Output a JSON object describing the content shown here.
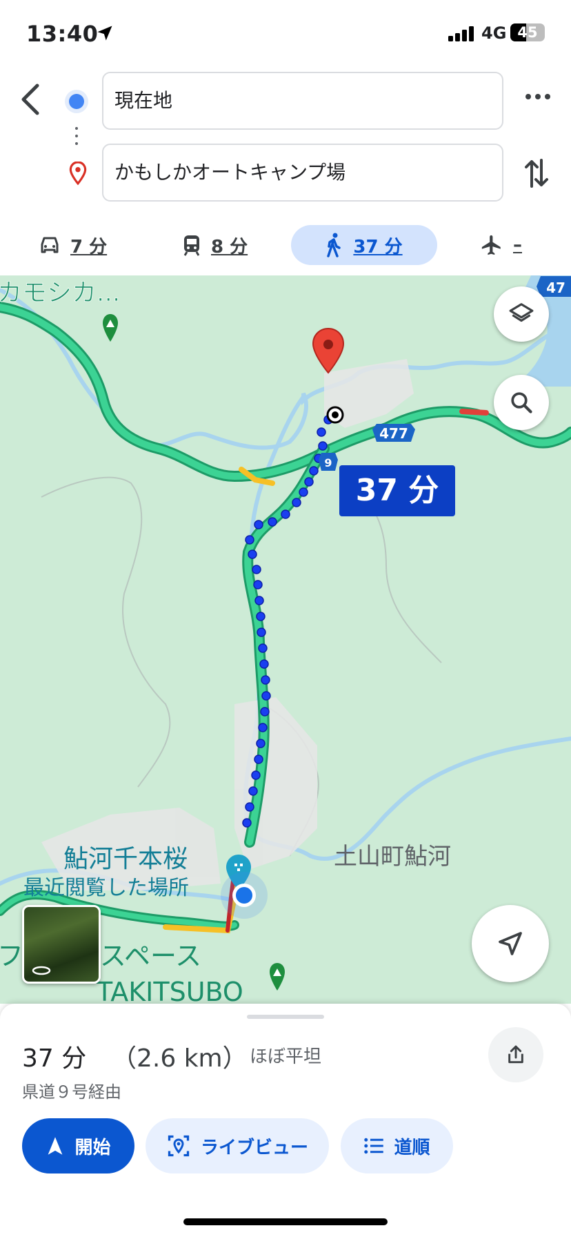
{
  "status_bar": {
    "time": "13:40",
    "network": "4G",
    "battery": "45",
    "battery_level": 0.45
  },
  "directions": {
    "origin": "現在地",
    "destination": "かもしかオートキャンプ場"
  },
  "modes": [
    {
      "icon": "car-icon",
      "time": "7 分"
    },
    {
      "icon": "train-icon",
      "time": "8 分"
    },
    {
      "icon": "walk-icon",
      "time": "37 分",
      "selected": true
    },
    {
      "icon": "flight-icon",
      "time": "–"
    }
  ],
  "map": {
    "eta_badge": "37 分",
    "route_shield": "477",
    "route_shield_small": "9",
    "edge_shield": "47",
    "labels": {
      "top_left": "カモシカ...",
      "town": "土山町鮎河",
      "place": "鮎河千本桜",
      "recent": "最近閲覧した場所",
      "bottom_place": "フ...ーアスペース",
      "bottom_place2": "TAKITSUBO"
    }
  },
  "summary": {
    "duration": "37 分",
    "distance": "（2.6 km）",
    "terrain": "ほぼ平坦",
    "via": "県道９号経由"
  },
  "actions": {
    "start": "開始",
    "live_view": "ライブビュー",
    "steps": "道順"
  },
  "colors": {
    "accent": "#0b57d0",
    "route": "#1a3ff0",
    "map_bg": "#cdebd6",
    "road": "#2fc08a"
  }
}
